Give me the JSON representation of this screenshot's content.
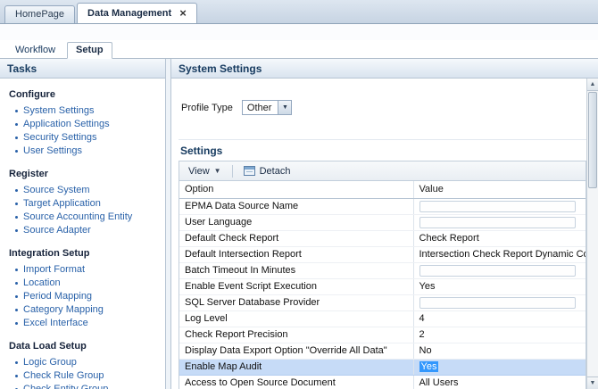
{
  "window": {
    "tabs": [
      {
        "label": "HomePage",
        "active": false,
        "closable": false
      },
      {
        "label": "Data Management",
        "active": true,
        "closable": true
      }
    ],
    "close_glyph": "×"
  },
  "subtabs": [
    {
      "label": "Workflow",
      "active": false
    },
    {
      "label": "Setup",
      "active": true
    }
  ],
  "sidebar": {
    "title": "Tasks",
    "sections": [
      {
        "title": "Configure",
        "items": [
          "System Settings",
          "Application Settings",
          "Security Settings",
          "User Settings"
        ]
      },
      {
        "title": "Register",
        "items": [
          "Source System",
          "Target Application",
          "Source Accounting Entity",
          "Source Adapter"
        ]
      },
      {
        "title": "Integration Setup",
        "items": [
          "Import Format",
          "Location",
          "Period Mapping",
          "Category Mapping",
          "Excel Interface"
        ]
      },
      {
        "title": "Data Load Setup",
        "items": [
          "Logic Group",
          "Check Rule Group",
          "Check Entity Group"
        ]
      }
    ]
  },
  "main": {
    "title": "System Settings",
    "profile_type": {
      "label": "Profile Type",
      "value": "Other"
    },
    "settings": {
      "title": "Settings",
      "toolbar": {
        "view_label": "View",
        "detach_label": "Detach"
      },
      "columns": [
        "Option",
        "Value"
      ],
      "rows": [
        {
          "option": "EPMA Data Source Name",
          "value": "",
          "editable": true,
          "selected": false
        },
        {
          "option": "User Language",
          "value": "",
          "editable": true,
          "selected": false
        },
        {
          "option": "Default Check Report",
          "value": "Check Report",
          "selected": false
        },
        {
          "option": "Default Intersection Report",
          "value": "Intersection Check Report Dynamic Columns",
          "selected": false
        },
        {
          "option": "Batch Timeout In Minutes",
          "value": "",
          "editable": true,
          "selected": false
        },
        {
          "option": "Enable Event Script Execution",
          "value": "Yes",
          "selected": false
        },
        {
          "option": "SQL Server Database Provider",
          "value": "",
          "editable": true,
          "selected": false
        },
        {
          "option": "Log Level",
          "value": "4",
          "selected": false
        },
        {
          "option": "Check Report Precision",
          "value": "2",
          "selected": false
        },
        {
          "option": "Display Data Export Option \"Override All Data\"",
          "value": "No",
          "selected": false
        },
        {
          "option": "Enable Map Audit",
          "value": "Yes",
          "selected": true
        },
        {
          "option": "Access to Open Source Document",
          "value": "All Users",
          "selected": false
        }
      ]
    }
  },
  "colors": {
    "link_blue": "#2a62a9",
    "panel_header_text": "#163a5f",
    "selected_row": "#c6dbf7",
    "text_selection": "#3297fd",
    "tab_bar": "#c7d4e3"
  }
}
